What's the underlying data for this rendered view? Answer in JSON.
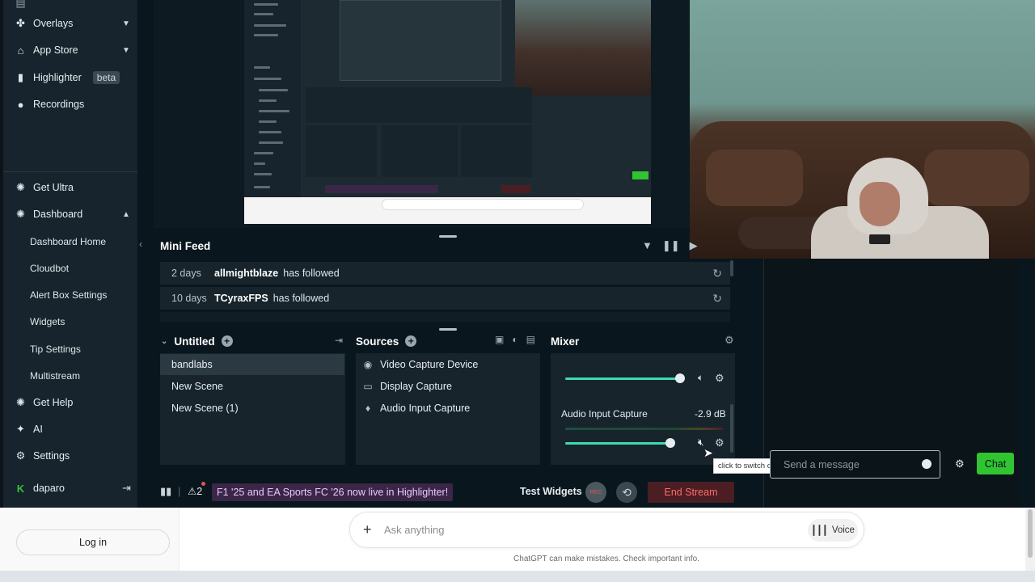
{
  "sidebar": {
    "top_items": [
      {
        "label": "Overlays",
        "icon": "overlays-icon"
      },
      {
        "label": "App Store",
        "icon": "store-icon"
      },
      {
        "label": "Highlighter",
        "icon": "highlighter-icon",
        "badge": "beta"
      },
      {
        "label": "Recordings",
        "icon": "recordings-icon"
      }
    ],
    "bottom_items": [
      {
        "label": "Get Ultra",
        "icon": "ultra-icon"
      },
      {
        "label": "Dashboard",
        "icon": "dashboard-icon"
      }
    ],
    "dashboard_sub": [
      "Dashboard Home",
      "Cloudbot",
      "Alert Box Settings",
      "Widgets",
      "Tip Settings",
      "Multistream"
    ],
    "footer_items": [
      {
        "label": "Get Help",
        "icon": "help-icon"
      },
      {
        "label": "AI",
        "icon": "ai-icon"
      },
      {
        "label": "Settings",
        "icon": "gear-icon"
      }
    ],
    "user": "daparo"
  },
  "minifeed": {
    "title": "Mini Feed",
    "rows": [
      {
        "time": "2 days",
        "user": "allmightblaze",
        "action": "has followed"
      },
      {
        "time": "10 days",
        "user": "TCyraxFPS",
        "action": "has followed"
      }
    ]
  },
  "scenes": {
    "title": "Untitled",
    "items": [
      "bandlabs",
      "New Scene",
      "New Scene (1)"
    ]
  },
  "sources": {
    "title": "Sources",
    "items": [
      {
        "label": "Video Capture Device",
        "icon": "webcam-icon"
      },
      {
        "label": "Display Capture",
        "icon": "monitor-icon"
      },
      {
        "label": "Audio Input Capture",
        "icon": "mic-icon"
      }
    ]
  },
  "mixer": {
    "title": "Mixer",
    "channel_name": "Audio Input Capture",
    "channel_db": "-2.9 dB",
    "tooltip": "click to switch on"
  },
  "statusbar": {
    "alerts_count": "2",
    "promo": "F1 '25 and EA Sports FC '26 now live in Highlighter!",
    "test_widgets": "Test Widgets",
    "rec_label": "REC",
    "end_stream": "End Stream"
  },
  "chat": {
    "placeholder": "Send a message",
    "button": "Chat"
  },
  "chatgpt": {
    "login": "Log in",
    "ask_placeholder": "Ask anything",
    "voice": "Voice",
    "disclaimer": "ChatGPT can make mistakes. Check important info."
  },
  "colors": {
    "accent_green": "#31c431",
    "end_stream_red": "#ff6b6b",
    "mixer_slider": "#3ddbb0"
  }
}
